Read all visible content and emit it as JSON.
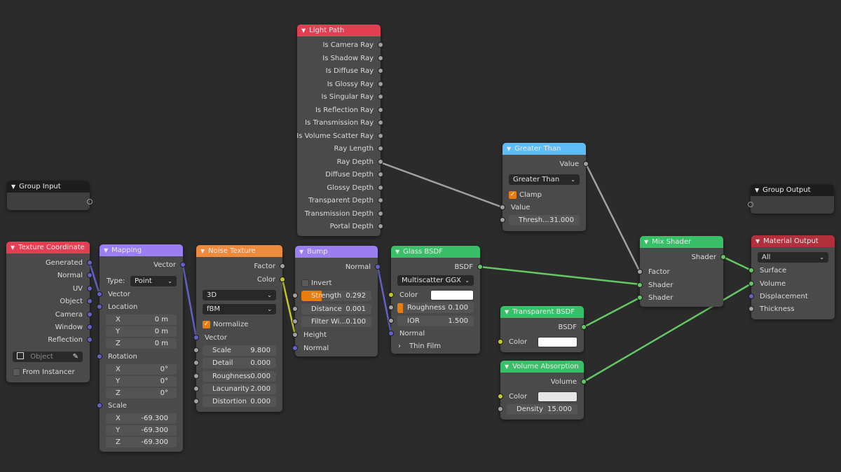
{
  "colors": {
    "background": "#2b2b2b",
    "node_body": "#4a4a4a",
    "header_input": "#e33f53",
    "header_vector": "#9b7ff0",
    "header_texture": "#ee8a3c",
    "header_converter": "#5fbcf6",
    "header_shader": "#39bf67",
    "header_output": "#b22f3c",
    "header_group": "#1d1d1d",
    "socket_vector": "#6363c7",
    "socket_float": "#a1a1a1",
    "socket_color": "#c7c729",
    "socket_shader": "#63c763",
    "field_accent": "#e87d0d"
  },
  "nodes": {
    "light_path": {
      "title": "Light Path",
      "outputs": [
        "Is Camera Ray",
        "Is Shadow Ray",
        "Is Diffuse Ray",
        "Is Glossy Ray",
        "Is Singular Ray",
        "Is Reflection Ray",
        "Is Transmission Ray",
        "Is Volume Scatter Ray",
        "Ray Length",
        "Ray Depth",
        "Diffuse Depth",
        "Glossy Depth",
        "Transparent Depth",
        "Transmission Depth",
        "Portal Depth"
      ]
    },
    "greater_than": {
      "title": "Greater Than",
      "output": "Value",
      "operation": "Greater Than",
      "clamp_label": "Clamp",
      "clamp": true,
      "input_value": "Value",
      "threshold_label": "Thresh...",
      "threshold_value": "31.000"
    },
    "group_input": {
      "title": "Group Input"
    },
    "group_output": {
      "title": "Group Output"
    },
    "texture_coordinate": {
      "title": "Texture Coordinate",
      "outputs": [
        "Generated",
        "Normal",
        "UV",
        "Object",
        "Camera",
        "Window",
        "Reflection"
      ],
      "object_placeholder": "Object",
      "from_instancer": "From Instancer"
    },
    "mapping": {
      "title": "Mapping",
      "output": "Vector",
      "type_label": "Type:",
      "type_value": "Point",
      "vector_label": "Vector",
      "location_label": "Location",
      "location": [
        [
          "X",
          "0 m"
        ],
        [
          "Y",
          "0 m"
        ],
        [
          "Z",
          "0 m"
        ]
      ],
      "rotation_label": "Rotation",
      "rotation": [
        [
          "X",
          "0°"
        ],
        [
          "Y",
          "0°"
        ],
        [
          "Z",
          "0°"
        ]
      ],
      "scale_label": "Scale",
      "scale": [
        [
          "X",
          "-69.300"
        ],
        [
          "Y",
          "-69.300"
        ],
        [
          "Z",
          "-69.300"
        ]
      ]
    },
    "noise_texture": {
      "title": "Noise Texture",
      "out_factor": "Factor",
      "out_color": "Color",
      "dimensions": "3D",
      "noise_type": "fBM",
      "normalize_label": "Normalize",
      "normalize": true,
      "vector_label": "Vector",
      "params": [
        [
          "Scale",
          "9.800"
        ],
        [
          "Detail",
          "0.000"
        ],
        [
          "Roughness",
          "0.000"
        ],
        [
          "Lacunarity",
          "2.000"
        ],
        [
          "Distortion",
          "0.000"
        ]
      ]
    },
    "bump": {
      "title": "Bump",
      "output": "Normal",
      "invert_label": "Invert",
      "invert": false,
      "strength_label": "Strength",
      "strength_value": "0.292",
      "strength_fraction": 0.292,
      "distance_label": "Distance",
      "distance_value": "0.001",
      "filter_label": "Filter Wi...",
      "filter_value": "0.100",
      "height_label": "Height",
      "normal_label": "Normal"
    },
    "glass_bsdf": {
      "title": "Glass BSDF",
      "output": "BSDF",
      "distribution": "Multiscatter GGX",
      "color_label": "Color",
      "color_value": "#ffffff",
      "roughness_label": "Roughness",
      "roughness_value": "0.100",
      "ior_label": "IOR",
      "ior_value": "1.500",
      "normal_label": "Normal",
      "thin_film_label": "Thin Film"
    },
    "transparent_bsdf": {
      "title": "Transparent BSDF",
      "output": "BSDF",
      "color_label": "Color",
      "color_value": "#ffffff"
    },
    "volume_absorption": {
      "title": "Volume Absorption",
      "output": "Volume",
      "color_label": "Color",
      "color_value": "#e6e6e6",
      "density_label": "Density",
      "density_value": "15.000"
    },
    "mix_shader": {
      "title": "Mix Shader",
      "output": "Shader",
      "inputs": [
        "Factor",
        "Shader",
        "Shader"
      ]
    },
    "material_output": {
      "title": "Material Output",
      "target": "All",
      "inputs": [
        "Surface",
        "Volume",
        "Displacement",
        "Thickness"
      ]
    }
  }
}
